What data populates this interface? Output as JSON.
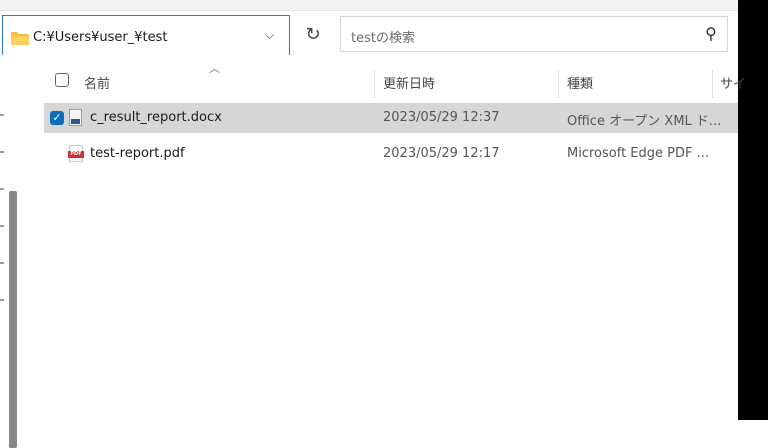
{
  "address": {
    "path": "C:¥Users¥user_¥test"
  },
  "search": {
    "placeholder": "testの検索"
  },
  "columns": {
    "name": "名前",
    "modified": "更新日時",
    "type": "種類",
    "size": "サイ"
  },
  "files": [
    {
      "name": "c_result_report.docx",
      "modified": "2023/05/29 12:37",
      "type": "Office オープン XML ド...",
      "selected": true
    },
    {
      "name": "test-report.pdf",
      "modified": "2023/05/29 12:17",
      "type": "Microsoft Edge PDF ...",
      "selected": false
    }
  ],
  "icons": {
    "folder": "folder-icon",
    "chevron": "chevron-down-icon",
    "refresh": "refresh-icon",
    "search": "search-icon",
    "docx": "word-document-icon",
    "pdf": "pdf-icon"
  },
  "colors": {
    "accent": "#0f6cbd",
    "selection": "#d6d6d6",
    "address_border": "#2b78d4"
  }
}
